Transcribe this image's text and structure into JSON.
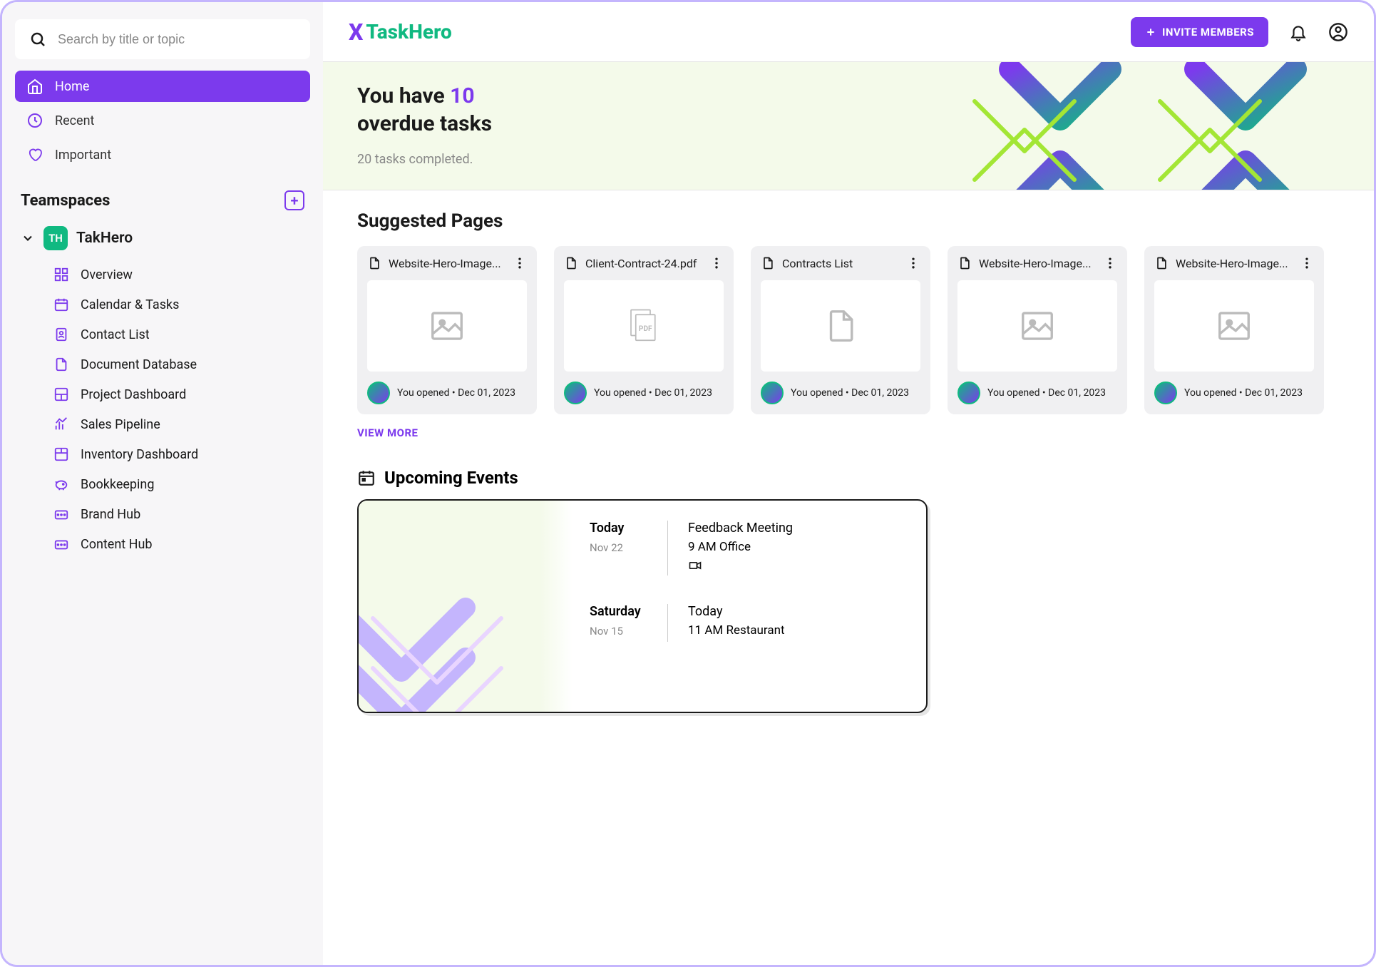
{
  "search": {
    "placeholder": "Search by title or topic"
  },
  "nav": [
    {
      "label": "Home",
      "icon": "home-icon",
      "active": true
    },
    {
      "label": "Recent",
      "icon": "clock-icon",
      "active": false
    },
    {
      "label": "Important",
      "icon": "heart-icon",
      "active": false
    }
  ],
  "teamspaces_label": "Teamspaces",
  "teamspace": {
    "badge": "TH",
    "name": "TakHero",
    "items": [
      {
        "label": "Overview",
        "icon": "grid-icon"
      },
      {
        "label": "Calendar & Tasks",
        "icon": "calendar-icon"
      },
      {
        "label": "Contact List",
        "icon": "contact-icon"
      },
      {
        "label": "Document Database",
        "icon": "document-icon"
      },
      {
        "label": "Project Dashboard",
        "icon": "dashboard-icon"
      },
      {
        "label": "Sales Pipeline",
        "icon": "chart-icon"
      },
      {
        "label": "Inventory Dashboard",
        "icon": "box-icon"
      },
      {
        "label": "Bookkeeping",
        "icon": "piggy-icon"
      },
      {
        "label": "Brand Hub",
        "icon": "brand-icon"
      },
      {
        "label": "Content Hub",
        "icon": "content-icon"
      }
    ]
  },
  "logo": {
    "x": "X",
    "name": "TaskHero"
  },
  "invite_label": "INVITE MEMBERS",
  "hero": {
    "prefix": "You have ",
    "count": "10",
    "suffix": "overdue tasks",
    "subtext": "20 tasks completed."
  },
  "suggested_title": "Suggested Pages",
  "cards": [
    {
      "title": "Website-Hero-Image...",
      "thumb": "image",
      "meta": "You opened • Dec 01, 2023"
    },
    {
      "title": "Client-Contract-24.pdf",
      "thumb": "pdf",
      "meta": "You opened • Dec 01, 2023"
    },
    {
      "title": "Contracts List",
      "thumb": "blank",
      "meta": "You opened • Dec 01, 2023"
    },
    {
      "title": "Website-Hero-Image...",
      "thumb": "image",
      "meta": "You opened • Dec 01, 2023"
    },
    {
      "title": "Website-Hero-Image...",
      "thumb": "image",
      "meta": "You opened • Dec 01, 2023"
    }
  ],
  "view_more": "VIEW MORE",
  "events_title": "Upcoming Events",
  "events": [
    {
      "day": "Today",
      "date": "Nov 22",
      "title": "Feedback Meeting",
      "time": "9 AM Office",
      "video": true
    },
    {
      "day": "Saturday",
      "date": "Nov 15",
      "title": "Today",
      "time": "11 AM Restaurant",
      "video": false
    }
  ]
}
